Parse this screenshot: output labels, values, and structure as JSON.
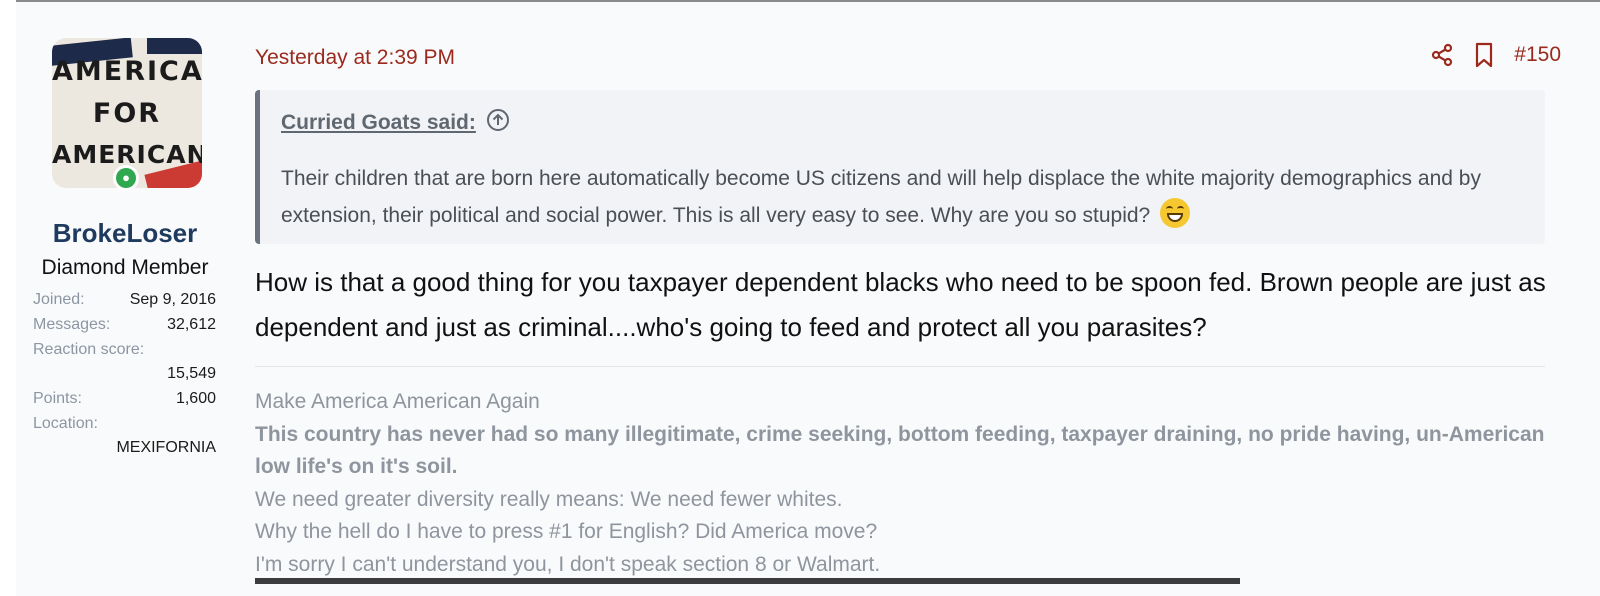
{
  "user": {
    "avatar_lines": [
      "AMERICA",
      "FOR",
      "AMERICANS"
    ],
    "username": "BrokeLoser",
    "title": "Diamond Member",
    "stats": {
      "joined_label": "Joined:",
      "joined_value": "Sep 9, 2016",
      "messages_label": "Messages:",
      "messages_value": "32,612",
      "reaction_label": "Reaction score:",
      "reaction_value": "15,549",
      "points_label": "Points:",
      "points_value": "1,600",
      "location_label": "Location:",
      "location_value": "MEXIFORNIA"
    }
  },
  "post": {
    "date": "Yesterday at 2:39 PM",
    "number": "#150",
    "quote": {
      "author": "Curried Goats said:",
      "text": "Their children that are born here automatically become US citizens and will help displace the white majority demographics and by extension, their political and social power. This is all very easy to see. Why are you so stupid?"
    },
    "message": "How is that a good thing for you taxpayer dependent blacks who need to be spoon fed. Brown people are just as dependent and just as criminal....who's going to feed and protect all you parasites?",
    "signature": {
      "line1": "Make America American Again",
      "line2_bold": "This country has never had so many illegitimate, crime seeking, bottom feeding, taxpayer draining, no pride having, un-American low life's on it's soil.",
      "line3": "We need greater diversity really means: We need fewer whites.",
      "line4": "Why the hell do I have to press #1 for English? Did America move?",
      "line5": "I'm sorry I can't understand you, I don't speak section 8 or Walmart."
    }
  },
  "icons": {
    "share": "share-icon",
    "bookmark": "bookmark-icon",
    "quote_jump": "arrow-up-circle-icon",
    "online": "user-online-icon",
    "emoji": "grinning-emoji-icon"
  },
  "colors": {
    "accent_red": "#9b2a1e",
    "username_blue": "#1e3a5f",
    "online_green": "#2fa84f",
    "muted_text": "#8f959e"
  }
}
